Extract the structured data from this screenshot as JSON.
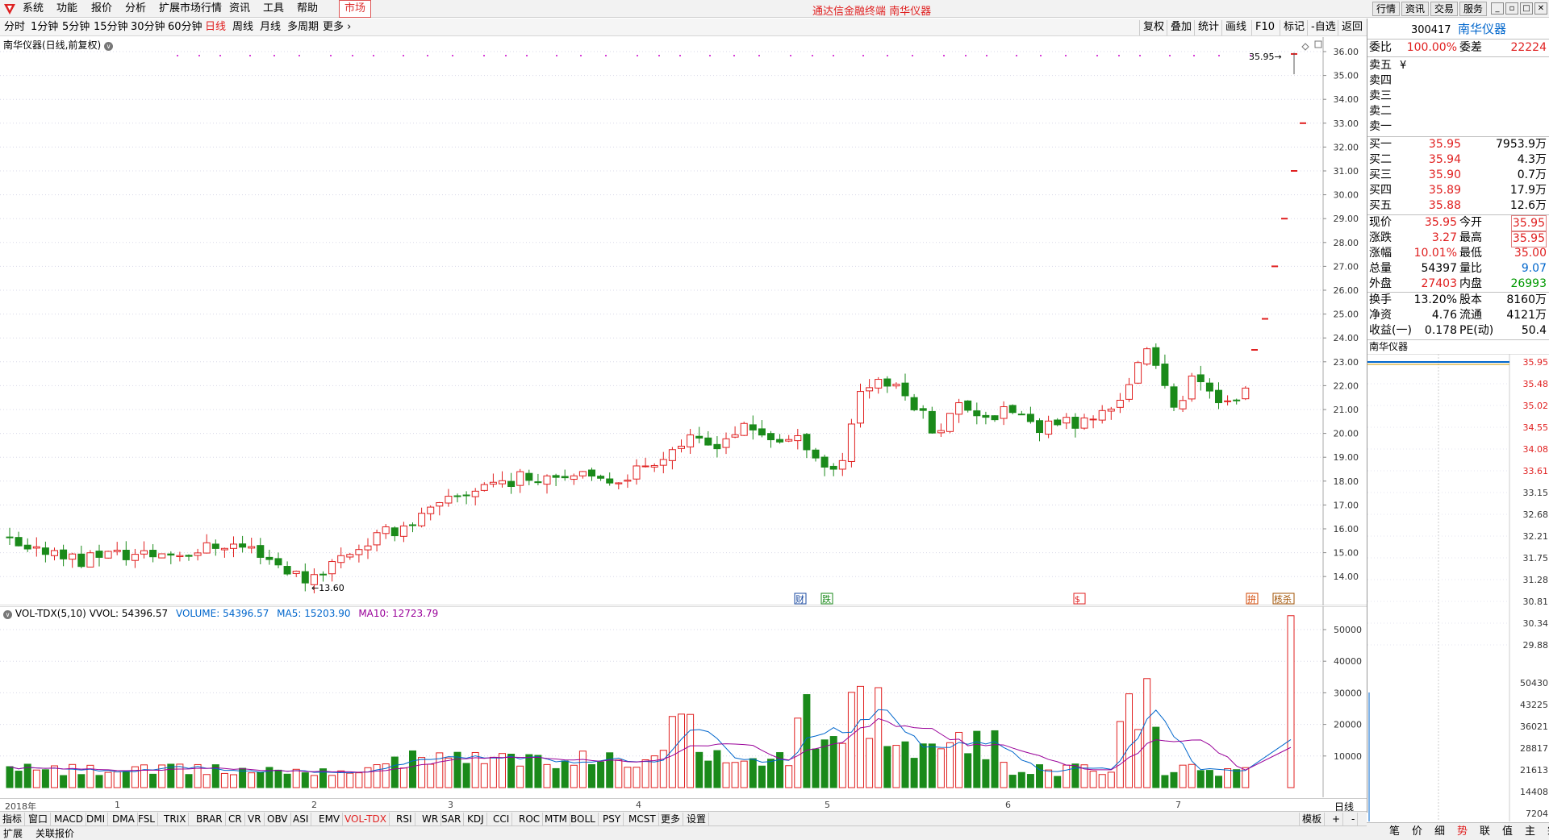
{
  "menu": {
    "items": [
      "系统",
      "功能",
      "报价",
      "分析",
      "扩展市场行情",
      "资讯",
      "工具",
      "帮助"
    ],
    "market": "市场",
    "title": "通达信金融终端  南华仪器",
    "top_buttons": [
      "行情",
      "资讯",
      "交易",
      "服务"
    ]
  },
  "periods": [
    "分时",
    "1分钟",
    "5分钟",
    "15分钟",
    "30分钟",
    "60分钟",
    "日线",
    "周线",
    "月线",
    "多周期",
    "更多"
  ],
  "active_period": "日线",
  "tools": [
    "复权",
    "叠加",
    "统计",
    "画线",
    "F10",
    "标记",
    "-自选",
    "返回"
  ],
  "chart_title": "南华仪器(日线,前复权)",
  "vol_legend": {
    "name": "VOL-TDX(5,10)",
    "vvol": "VVOL: 54396.57",
    "volume": "VOLUME: 54396.57",
    "ma5": "MA5: 15203.90",
    "ma10": "MA10: 12723.79"
  },
  "price_axis": [
    "36.00",
    "35.00",
    "34.00",
    "33.00",
    "32.00",
    "31.00",
    "30.00",
    "29.00",
    "28.00",
    "27.00",
    "26.00",
    "25.00",
    "24.00",
    "23.00",
    "22.00",
    "21.00",
    "20.00",
    "19.00",
    "18.00",
    "17.00",
    "16.00",
    "15.00",
    "14.00"
  ],
  "vol_axis": [
    "50000",
    "40000",
    "30000",
    "20000",
    "10000"
  ],
  "x_labels": [
    "2018年",
    "1",
    "2",
    "3",
    "4",
    "5",
    "6",
    "7"
  ],
  "x_unit": "日线",
  "annotations": {
    "low": "13.60",
    "high": "35.95"
  },
  "markers": [
    "财",
    "跌",
    "$",
    "拚",
    "核杀"
  ],
  "indicators": [
    "指标",
    "窗口",
    "MACD",
    "DMI",
    "DMA",
    "FSL",
    "TRIX",
    "BRAR",
    "CR",
    "VR",
    "OBV",
    "ASI",
    "EMV",
    "VOL-TDX",
    "RSI",
    "WR",
    "SAR",
    "KDJ",
    "CCI",
    "ROC",
    "MTM",
    "BOLL",
    "PSY",
    "MCST",
    "更多",
    "设置"
  ],
  "active_indicator": "VOL-TDX",
  "template_label": "模板",
  "status": [
    "扩展",
    "关联报价"
  ],
  "quote": {
    "code": "300417",
    "name": "南华仪器",
    "weibi_label": "委比",
    "weibi": "100.00%",
    "weicha_label": "委差",
    "weicha": "22224",
    "sells": [
      {
        "label": "卖五",
        "price": "",
        "vol": ""
      },
      {
        "label": "卖四",
        "price": "",
        "vol": ""
      },
      {
        "label": "卖三",
        "price": "",
        "vol": ""
      },
      {
        "label": "卖二",
        "price": "",
        "vol": ""
      },
      {
        "label": "卖一",
        "price": "",
        "vol": ""
      }
    ],
    "sell_mark": "¥",
    "buys": [
      {
        "label": "买一",
        "price": "35.95",
        "vol": "7953.9万"
      },
      {
        "label": "买二",
        "price": "35.94",
        "vol": "4.3万"
      },
      {
        "label": "买三",
        "price": "35.90",
        "vol": "0.7万"
      },
      {
        "label": "买四",
        "price": "35.89",
        "vol": "17.9万"
      },
      {
        "label": "买五",
        "price": "35.88",
        "vol": "12.6万"
      }
    ],
    "stats": [
      {
        "k1": "现价",
        "v1": "35.95",
        "k2": "今开",
        "v2": "35.95"
      },
      {
        "k1": "涨跌",
        "v1": "3.27",
        "k2": "最高",
        "v2": "35.95"
      },
      {
        "k1": "涨幅",
        "v1": "10.01%",
        "k2": "最低",
        "v2": "35.00"
      },
      {
        "k1": "总量",
        "v1": "54397",
        "k2": "量比",
        "v2": "9.07"
      },
      {
        "k1": "外盘",
        "v1": "27403",
        "k2": "内盘",
        "v2": "26993"
      }
    ],
    "stats2": [
      {
        "k1": "换手",
        "v1": "13.20%",
        "k2": "股本",
        "v2": "8160万"
      },
      {
        "k1": "净资",
        "v1": "4.76",
        "k2": "流通",
        "v2": "4121万"
      },
      {
        "k1": "收益(一)",
        "v1": "0.178",
        "k2": "PE(动)",
        "v2": "50.4"
      }
    ],
    "mini_title": "南华仪器",
    "mini_price_axis": [
      "35.95",
      "35.48",
      "35.02",
      "34.55",
      "34.08",
      "33.61",
      "33.15",
      "32.68",
      "32.21",
      "31.75",
      "31.28",
      "30.81",
      "30.34",
      "29.88"
    ],
    "mini_vol_axis": [
      "50430",
      "43225",
      "36021",
      "28817",
      "21613",
      "14408",
      "7204"
    ]
  },
  "detail_tabs": [
    "笔",
    "价",
    "细",
    "势",
    "联",
    "值",
    "主",
    "筹"
  ],
  "active_detail_tab": "势",
  "colors": {
    "up": "#e02020",
    "down": "#1a8a1a",
    "ma5": "#0066cc",
    "ma10": "#990099",
    "bg": "#ffffff"
  }
}
